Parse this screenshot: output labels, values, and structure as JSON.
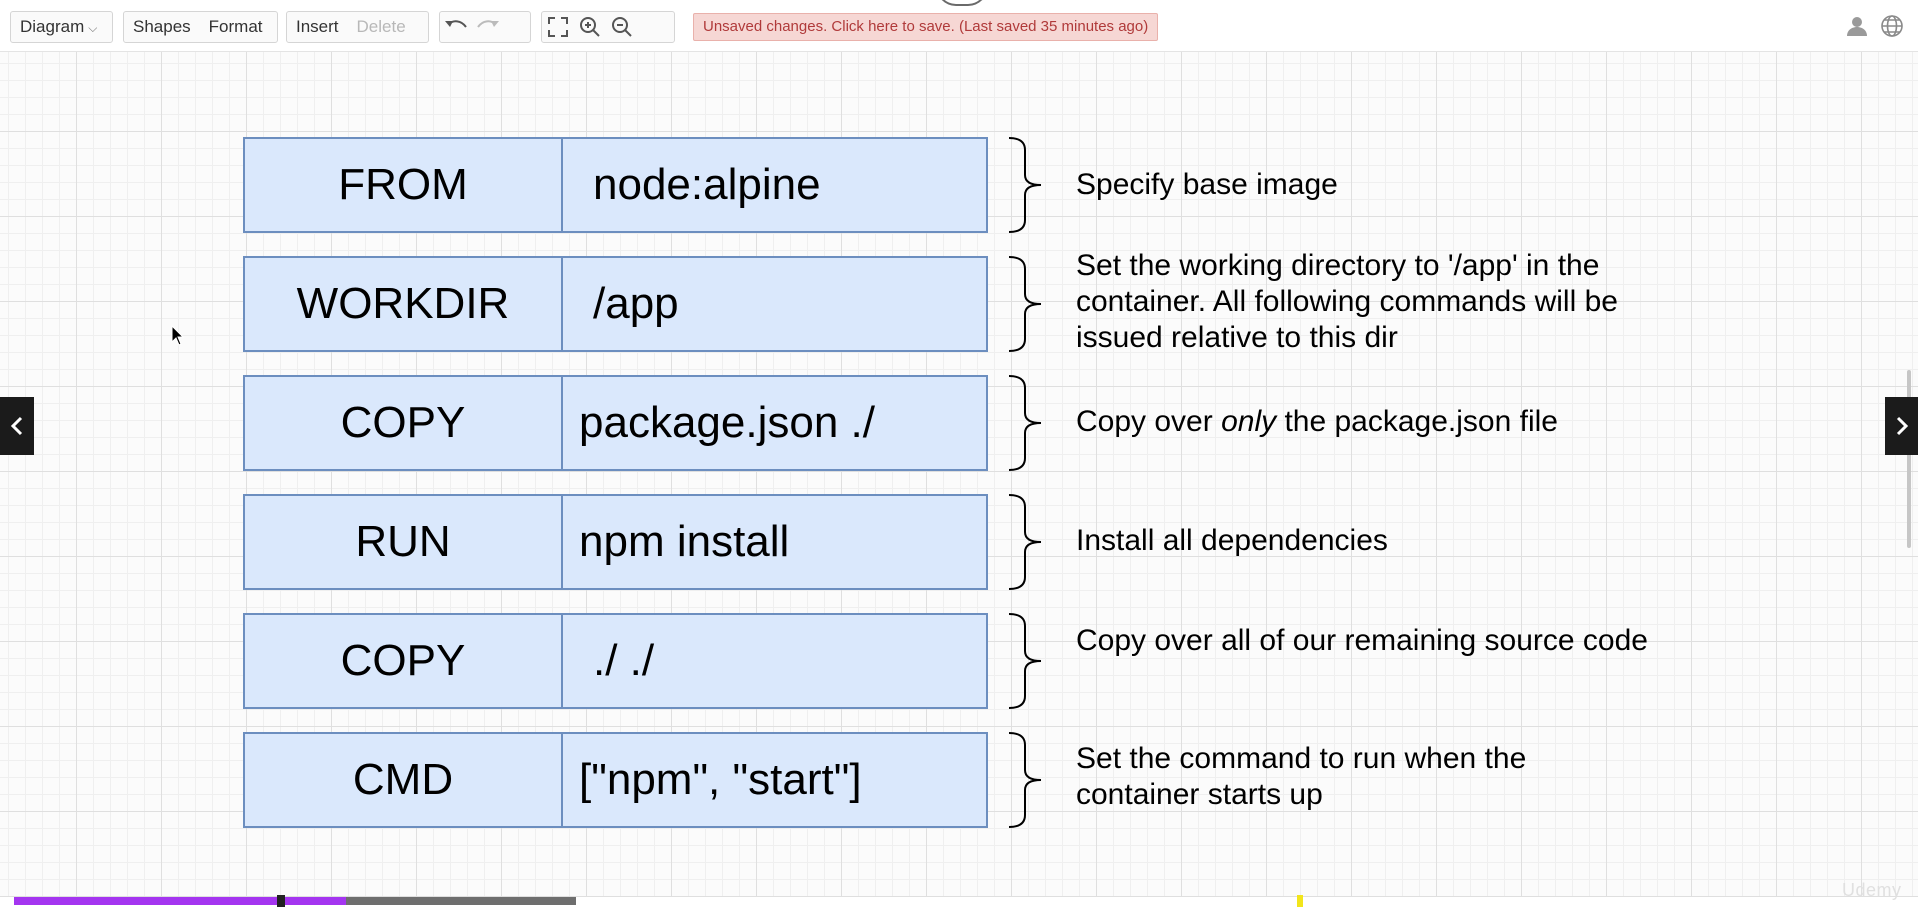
{
  "toolbar": {
    "diagram_label": "Diagram",
    "shapes_label": "Shapes",
    "format_label": "Format",
    "insert_label": "Insert",
    "delete_label": "Delete",
    "icons": [
      "undo-icon",
      "redo-icon",
      "fullscreen-icon",
      "zoom-in-icon",
      "zoom-out-icon"
    ],
    "save_notice": "Unsaved changes. Click here to save. (Last saved 35 minutes ago)",
    "right_icons": [
      "user-icon",
      "globe-icon"
    ]
  },
  "diagram": {
    "rows": [
      {
        "key": "FROM",
        "value": "node:alpine",
        "description": "Specify base image"
      },
      {
        "key": "WORKDIR",
        "value": "/app",
        "description": "Set the working directory to '/app' in the container.  All following commands will be issued relative to this dir"
      },
      {
        "key": "COPY",
        "value": "package.json ./",
        "description_before": "Copy over ",
        "description_emphasis": "only",
        "description_after": " the package.json file"
      },
      {
        "key": "RUN",
        "value": "npm install",
        "description": "Install all dependencies"
      },
      {
        "key": "COPY",
        "value": "./ ./",
        "description": "Copy over all of our remaining source code"
      },
      {
        "key": "CMD",
        "value": "[\"npm\", \"start\"]",
        "description": "Set the command to run when the container starts up"
      }
    ]
  },
  "colors": {
    "cell_fill": "#dae8fc",
    "cell_border": "#6c8ebf",
    "save_notice_bg": "#f6d7d4",
    "save_notice_text": "#b03a3a",
    "progress_played": "#a435f0",
    "progress_buffered": "#6e6e6e"
  },
  "watermark": "Udemy",
  "video_progress": {
    "played_fraction": 0.59,
    "handle_fraction": 0.475
  },
  "nav": {
    "prev_icon": "chevron-left-icon",
    "next_icon": "chevron-right-icon"
  }
}
